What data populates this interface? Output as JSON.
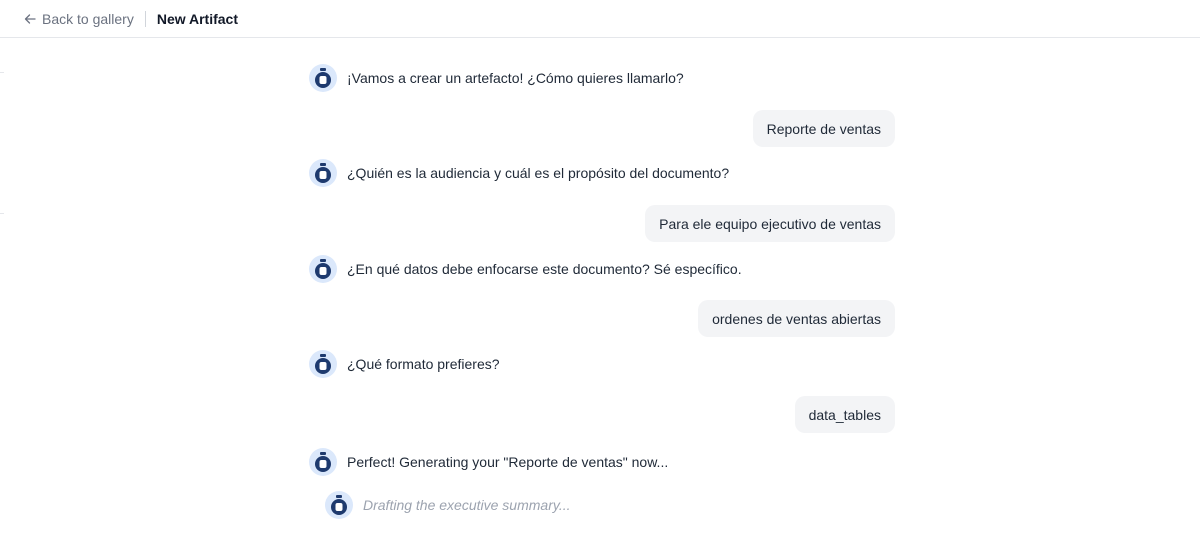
{
  "header": {
    "back_label": "Back to gallery",
    "title": "New Artifact"
  },
  "colors": {
    "avatar_ring": "#dbe8fb",
    "avatar_body": "#1e3a6e",
    "user_bubble": "#f3f4f6",
    "pending_text": "#9ca3af"
  },
  "conversation": [
    {
      "role": "assistant",
      "text": "¡Vamos a crear un artefacto! ¿Cómo quieres llamarlo?"
    },
    {
      "role": "user",
      "text": "Reporte de ventas"
    },
    {
      "role": "assistant",
      "text": "¿Quién es la audiencia y cuál es el propósito del documento?"
    },
    {
      "role": "user",
      "text": "Para ele equipo ejecutivo de ventas"
    },
    {
      "role": "assistant",
      "text": "¿En qué datos debe enfocarse este documento? Sé específico."
    },
    {
      "role": "user",
      "text": "ordenes de ventas abiertas"
    },
    {
      "role": "assistant",
      "text": "¿Qué formato prefieres?"
    },
    {
      "role": "user",
      "text": "data_tables"
    },
    {
      "role": "assistant",
      "text": "Perfect! Generating your \"Reporte de ventas\" now..."
    }
  ],
  "status": {
    "text": "Drafting the executive summary..."
  }
}
